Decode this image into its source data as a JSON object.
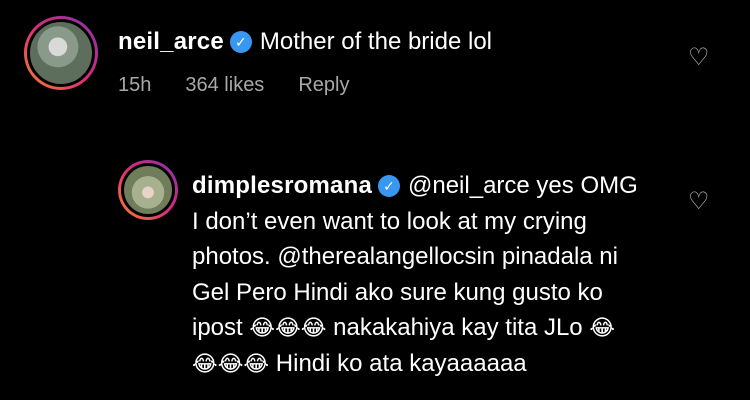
{
  "comment": {
    "username": "neil_arce",
    "text": "Mother of the bride lol",
    "time": "15h",
    "likes": "364 likes",
    "reply_label": "Reply"
  },
  "reply": {
    "username": "dimplesromana",
    "line1": "@neil_arce yes OMG",
    "line2": "I don’t even want to look at my crying",
    "line3": "photos. @therealangellocsin pinadala ni",
    "line4": "Gel Pero Hindi ako sure kung gusto ko",
    "line5_a": "ipost",
    "line5_emojis": "😂😂😂",
    "line5_b": "nakakahiya kay tita JLo",
    "line5_emoji": "😂",
    "line6_emojis": "😂😂😂",
    "line6_b": "Hindi ko ata kayaaaaaa"
  },
  "icons": {
    "verified": "verified-badge-icon",
    "heart": "heart-outline-icon",
    "verified_color": "#3897f0"
  }
}
